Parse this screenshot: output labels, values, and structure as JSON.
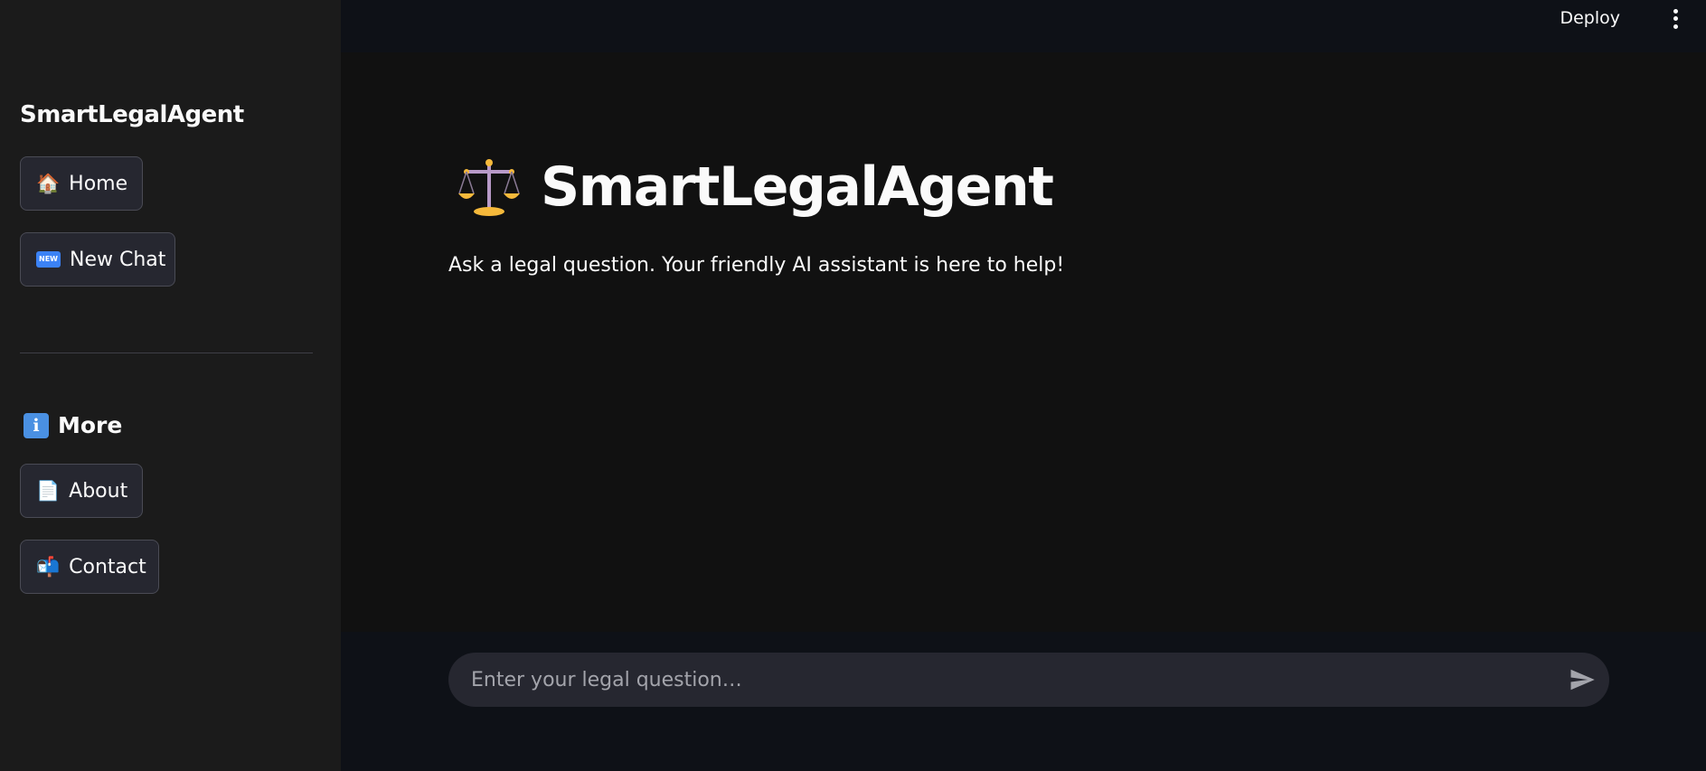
{
  "sidebar": {
    "title": "SmartLegalAgent",
    "buttons": [
      {
        "emoji": "🏠",
        "label": "Home"
      },
      {
        "emoji": "NEW",
        "label": "New Chat"
      }
    ],
    "more_section": {
      "icon": "info-icon",
      "heading": "More",
      "buttons": [
        {
          "emoji": "📄",
          "label": "About"
        },
        {
          "emoji": "📬",
          "label": "Contact"
        }
      ]
    }
  },
  "header": {
    "deploy_label": "Deploy",
    "menu_icon": "vertical-dots-icon"
  },
  "main": {
    "title_icon": "balance-scale-icon",
    "title": "SmartLegalAgent",
    "subtitle": "Ask a legal question. Your friendly AI assistant is here to help!"
  },
  "chat": {
    "placeholder": "Enter your legal question…",
    "value": "",
    "send_icon": "send-icon"
  },
  "colors": {
    "main_bg": "#111111",
    "sidebar_bg": "#1b1b1b",
    "header_bg": "#0e1117",
    "button_bg": "#262730",
    "text": "#fafafa"
  }
}
